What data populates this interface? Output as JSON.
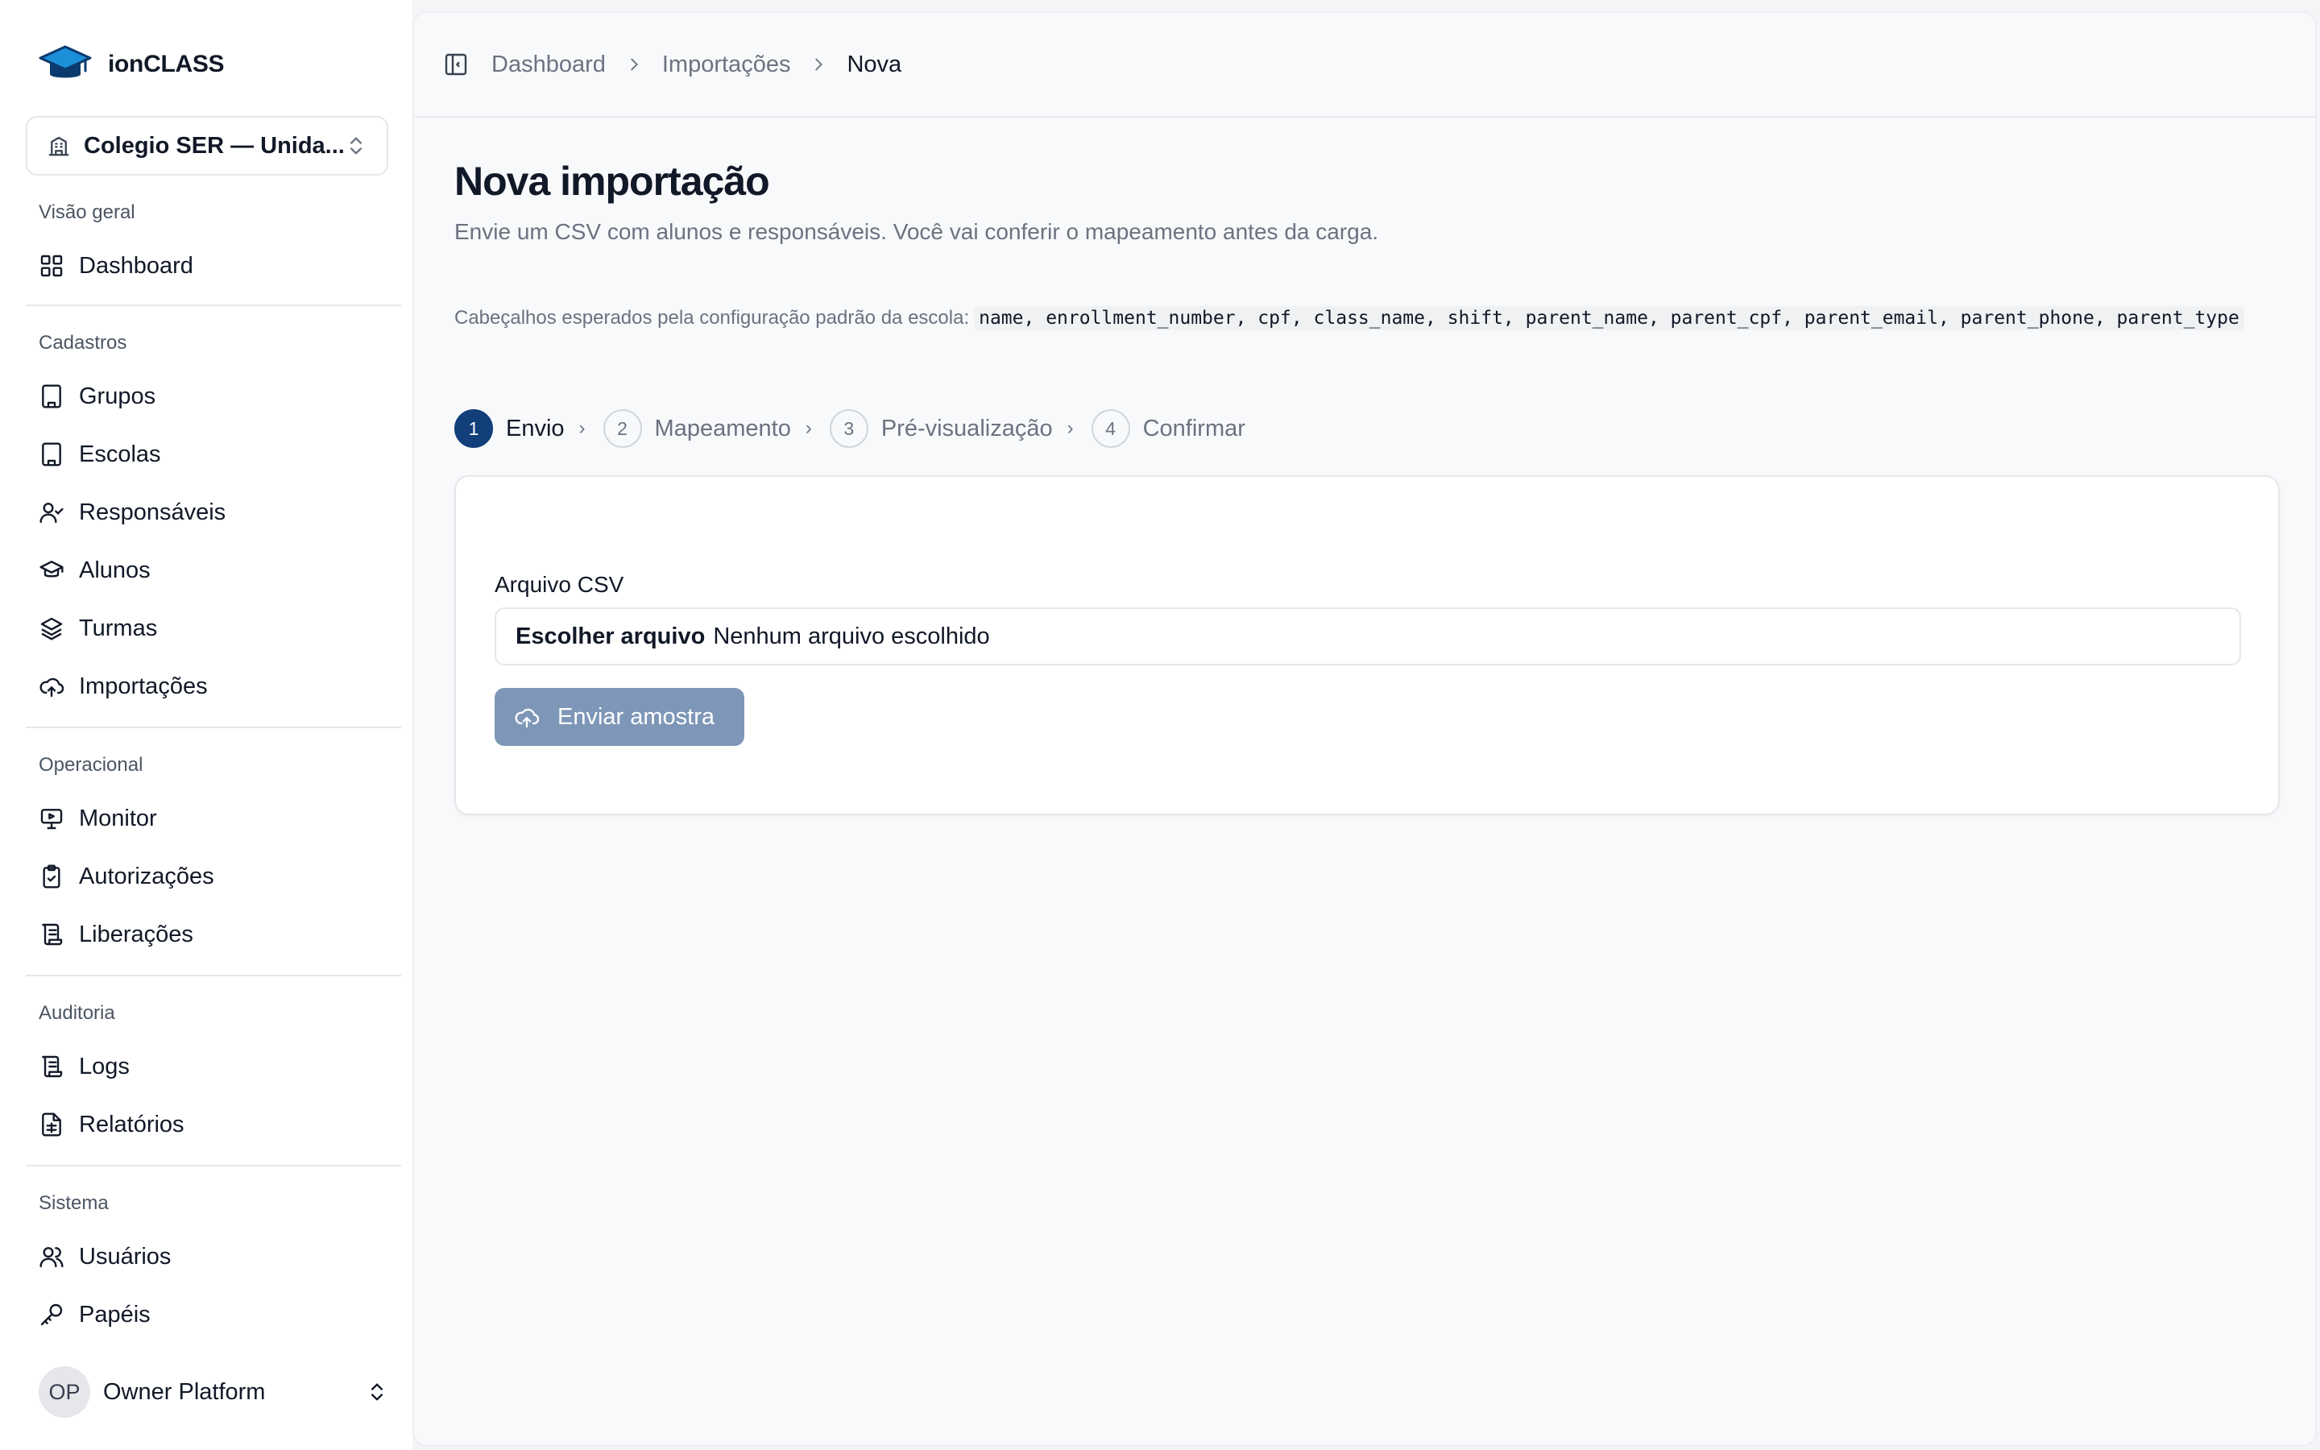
{
  "app": {
    "name": "ionCLASS"
  },
  "org_selector": {
    "value": "Colegio SER — Unida..."
  },
  "sidebar": {
    "groups": [
      {
        "label": "Visão geral",
        "items": [
          {
            "label": "Dashboard",
            "icon": "grid-icon"
          }
        ]
      },
      {
        "label": "Cadastros",
        "items": [
          {
            "label": "Grupos",
            "icon": "building-icon"
          },
          {
            "label": "Escolas",
            "icon": "building-icon"
          },
          {
            "label": "Responsáveis",
            "icon": "user-check-icon"
          },
          {
            "label": "Alunos",
            "icon": "graduation-cap-icon"
          },
          {
            "label": "Turmas",
            "icon": "layers-icon"
          },
          {
            "label": "Importações",
            "icon": "cloud-upload-icon"
          }
        ]
      },
      {
        "label": "Operacional",
        "items": [
          {
            "label": "Monitor",
            "icon": "monitor-icon"
          },
          {
            "label": "Autorizações",
            "icon": "clipboard-check-icon"
          },
          {
            "label": "Liberações",
            "icon": "scroll-icon"
          }
        ]
      },
      {
        "label": "Auditoria",
        "items": [
          {
            "label": "Logs",
            "icon": "scroll-icon"
          },
          {
            "label": "Relatórios",
            "icon": "file-spreadsheet-icon"
          }
        ]
      },
      {
        "label": "Sistema",
        "items": [
          {
            "label": "Usuários",
            "icon": "users-icon"
          },
          {
            "label": "Papéis",
            "icon": "key-icon"
          }
        ]
      }
    ]
  },
  "user": {
    "initials": "OP",
    "name": "Owner Platform"
  },
  "breadcrumb": [
    "Dashboard",
    "Importações",
    "Nova"
  ],
  "page": {
    "title": "Nova importação",
    "subtitle": "Envie um CSV com alunos e responsáveis. Você vai conferir o mapeamento antes da carga.",
    "headers_note": "Cabeçalhos esperados pela configuração padrão da escola:",
    "headers_code": "name, enrollment_number, cpf, class_name, shift, parent_name, parent_cpf, parent_email, parent_phone, parent_type"
  },
  "steps": [
    {
      "number": "1",
      "label": "Envio",
      "active": true
    },
    {
      "number": "2",
      "label": "Mapeamento",
      "active": false
    },
    {
      "number": "3",
      "label": "Pré-visualização",
      "active": false
    },
    {
      "number": "4",
      "label": "Confirmar",
      "active": false
    }
  ],
  "form": {
    "field_label": "Arquivo CSV",
    "file_button": "Escolher arquivo",
    "file_status": "Nenhum arquivo escolhido",
    "submit_label": "Enviar amostra"
  },
  "colors": {
    "brand_blue": "#1d8fd9",
    "brand_navy": "#123f7a",
    "disabled_button": "#7e97b8"
  }
}
